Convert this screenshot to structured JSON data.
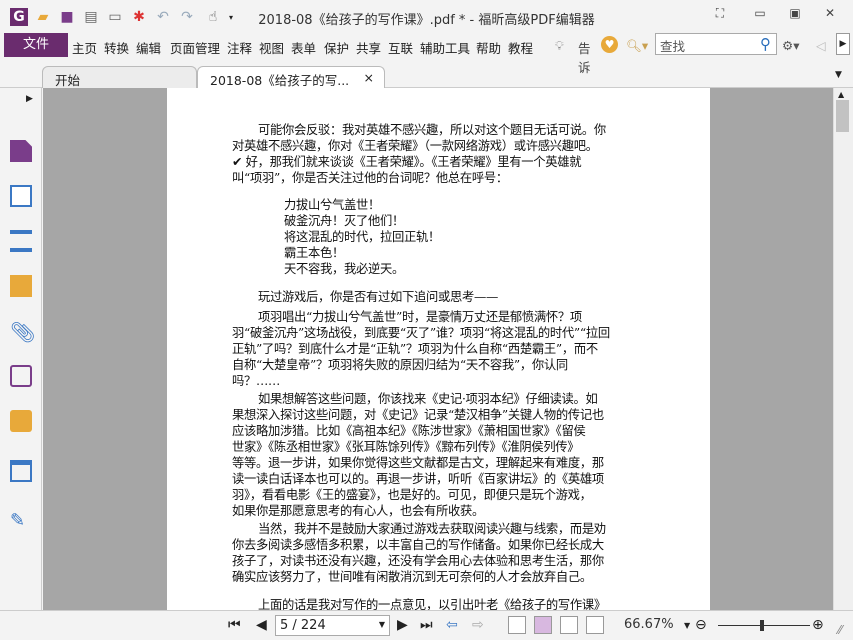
{
  "app": {
    "title": "2018-08《给孩子的写作课》.pdf * - 福昕高级PDF编辑器",
    "brand_color": "#6a2c6e"
  },
  "menu": {
    "file": "文件",
    "items": [
      "主页",
      "转换",
      "编辑",
      "页面管理",
      "注释",
      "视图",
      "表单",
      "保护",
      "共享",
      "互联",
      "辅助工具",
      "帮助",
      "教程"
    ],
    "tell": "告诉",
    "search_placeholder": "查找"
  },
  "tabs": [
    {
      "label": "开始"
    },
    {
      "label": "2018-08《给孩子的写...",
      "close": "×"
    }
  ],
  "document": {
    "paragraphs": [
      {
        "type": "ind",
        "lines": [
          "可能你会反驳：我对英雄不感兴趣，所以对这个题目无话可说。你",
          "对英雄不感兴趣，你对《王者荣耀》（一款网络游戏）或许感兴趣吧。",
          "✔ 好，那我们就来谈谈《王者荣耀》。《王者荣耀》里有一个英雄就",
          "叫“项羽”，你是否关注过他的台词呢？他总在呼号："
        ]
      },
      {
        "type": "verse",
        "lines": [
          "力拔山兮气盖世！",
          "破釜沉舟！灭了他们！",
          "将这混乱的时代，拉回正轨！",
          "霸王本色！",
          "天不容我，我必逆天。"
        ]
      },
      {
        "type": "ind",
        "lines": [
          "玩过游戏后，你是否有过如下追问或思考——"
        ]
      },
      {
        "type": "ind",
        "lines": [
          "项羽唱出“力拔山兮气盖世”时，是豪情万丈还是郁愤满怀？项",
          "羽“破釜沉舟”这场战役，到底要“灭了”谁？项羽“将这混乱的时代”“拉回",
          "正轨”了吗？到底什么才是“正轨”？项羽为什么自称“西楚霸王”，而不",
          "自称“大楚皇帝”？项羽将失败的原因归结为“天不容我”，你认同",
          "吗？……"
        ]
      },
      {
        "type": "ind",
        "lines": [
          "如果想解答这些问题，你该找来《史记·项羽本纪》仔细读读。如",
          "果想深入探讨这些问题，对《史记》记录“楚汉相争”关键人物的传记也",
          "应该略加涉猎。比如《高祖本纪》《陈涉世家》《萧相国世家》《留侯",
          "世家》《陈丞相世家》《张耳陈馀列传》《黥布列传》《淮阴侯列传》",
          "等等。退一步讲，如果你觉得这些文献都是古文，理解起来有难度，那",
          "读一读白话译本也可以的。再退一步讲，听听《百家讲坛》的《英雄项",
          "羽》，看看电影《王的盛宴》，也是好的。可见，即便只是玩个游戏，",
          "如果你是那愿意思考的有心人，也会有所收获。"
        ]
      },
      {
        "type": "ind",
        "lines": [
          "当然，我并不是鼓励大家通过游戏去获取阅读兴趣与线索，而是劝",
          "你去多阅读多感悟多积累，以丰富自己的写作储备。如果你已经长成大",
          "孩子了，对读书还没有兴趣，还没有学会用心去体验和思考生活，那你",
          "确实应该努力了，世间唯有闲散消沉到无可奈何的人才会放弃自己。"
        ]
      },
      {
        "type": "ind",
        "lines": [
          "上面的话是我对写作的一点意见，以引出叶老《给孩子的写作课》"
        ]
      }
    ]
  },
  "status": {
    "page": "5 / 224",
    "zoom": "66.67%",
    "zoom_fraction": 0.6667
  }
}
